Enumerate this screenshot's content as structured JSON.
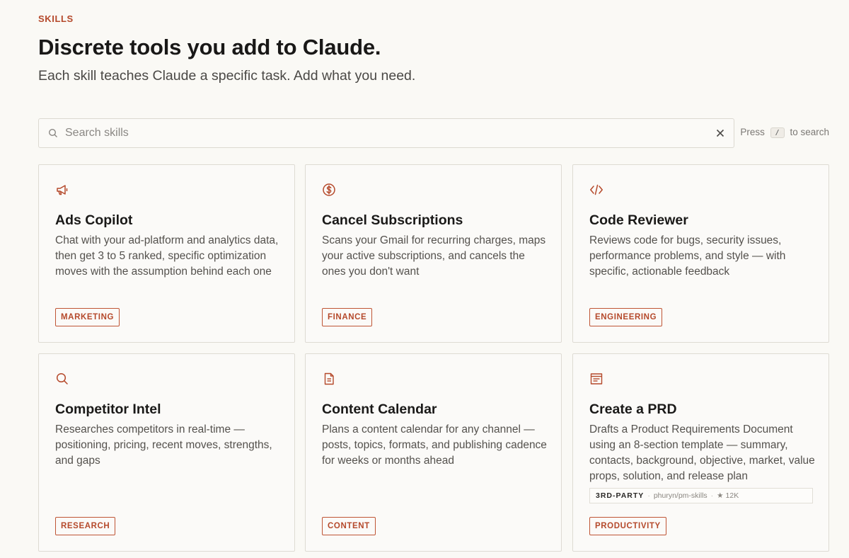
{
  "header": {
    "eyebrow": "SKILLS",
    "headline": "Discrete tools you add to Claude.",
    "subhead": "Each skill teaches Claude a specific task. Add what you need."
  },
  "search": {
    "placeholder": "Search skills",
    "value": "",
    "hint_prefix": "Press",
    "hint_key": "/",
    "hint_suffix": "to search"
  },
  "colors": {
    "accent": "#b5492b",
    "background": "#faf9f5",
    "card_border": "#dedbd3"
  },
  "skills": [
    {
      "icon": "megaphone-icon",
      "title": "Ads Copilot",
      "description": "Chat with your ad-platform and analytics data, then get 3 to 5 ranked, specific optimization moves with the assumption behind each one",
      "tag": "MARKETING"
    },
    {
      "icon": "dollar-circle-icon",
      "title": "Cancel Subscriptions",
      "description": "Scans your Gmail for recurring charges, maps your active subscriptions, and cancels the ones you don't want",
      "tag": "FINANCE"
    },
    {
      "icon": "code-icon",
      "title": "Code Reviewer",
      "description": "Reviews code for bugs, security issues, performance problems, and style — with specific, actionable feedback",
      "tag": "ENGINEERING"
    },
    {
      "icon": "search-icon",
      "title": "Competitor Intel",
      "description": "Researches competitors in real-time — positioning, pricing, recent moves, strengths, and gaps",
      "tag": "RESEARCH"
    },
    {
      "icon": "document-icon",
      "title": "Content Calendar",
      "description": "Plans a content calendar for any channel — posts, topics, formats, and publishing cadence for weeks or months ahead",
      "tag": "CONTENT"
    },
    {
      "icon": "browser-window-icon",
      "title": "Create a PRD",
      "description": "Drafts a Product Requirements Document using an 8-section template — summary, contacts, background, objective, market, value props, solution, and release plan",
      "tag": "PRODUCTIVITY",
      "meta": {
        "badge": "3RD-PARTY",
        "source": "phuryn/pm-skills",
        "stars": "12K"
      }
    }
  ]
}
